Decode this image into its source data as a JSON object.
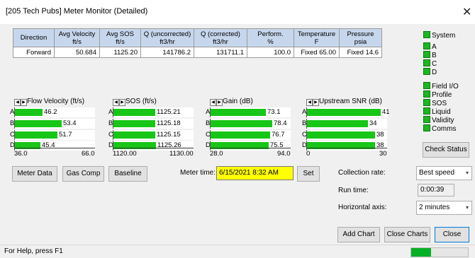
{
  "window": {
    "title": "[205 Tech Pubs] Meter Monitor (Detailed)"
  },
  "table": {
    "headers": [
      "Direction",
      "Avg Velocity\nft/s",
      "Avg SOS\nft/s",
      "Q (uncorrected)\nft3/hr",
      "Q (corrected)\nft3/hr",
      "Perform.\n%",
      "Temperature\nF",
      "Pressure\npsia"
    ],
    "rows": [
      [
        "Forward",
        "50.684",
        "1125.20",
        "141786.2",
        "131711.1",
        "100.0",
        "Fixed 65.00",
        "Fixed 14.6"
      ]
    ]
  },
  "status_items": [
    {
      "label": "System",
      "color": "#1fb424"
    },
    {
      "label": "A",
      "color": "#1fb424"
    },
    {
      "label": "B",
      "color": "#1fb424"
    },
    {
      "label": "C",
      "color": "#1fb424"
    },
    {
      "label": "D",
      "color": "#1fb424"
    },
    {
      "label": "Field I/O",
      "color": "#1fb424"
    },
    {
      "label": "Profile",
      "color": "#1fb424"
    },
    {
      "label": "SOS",
      "color": "#1fb424"
    },
    {
      "label": "Liquid",
      "color": "#1fb424"
    },
    {
      "label": "Validity",
      "color": "#1fb424"
    },
    {
      "label": "Comms",
      "color": "#1fb424"
    }
  ],
  "buttons": {
    "check_status": "Check Status",
    "meter_data": "Meter Data",
    "gas_comp": "Gas Comp",
    "baseline": "Baseline",
    "set": "Set",
    "add_chart": "Add Chart",
    "close_charts": "Close Charts",
    "close": "Close"
  },
  "gauges": [
    {
      "title": "Flow Velocity (ft/s)",
      "min": 36.0,
      "max": 66.0,
      "min_label": "36.0",
      "max_label": "66.0",
      "rows": [
        {
          "path": "A",
          "value": 46.2,
          "label": "46.2"
        },
        {
          "path": "B",
          "value": 53.4,
          "label": "53.4"
        },
        {
          "path": "C",
          "value": 51.7,
          "label": "51.7"
        },
        {
          "path": "D",
          "value": 45.4,
          "label": "45.4"
        }
      ]
    },
    {
      "title": "SOS (ft/s)",
      "min": 1120.0,
      "max": 1130.0,
      "min_label": "1120.00",
      "max_label": "1130.00",
      "rows": [
        {
          "path": "A",
          "value": 1125.21,
          "label": "1125.21"
        },
        {
          "path": "B",
          "value": 1125.18,
          "label": "1125.18"
        },
        {
          "path": "C",
          "value": 1125.15,
          "label": "1125.15"
        },
        {
          "path": "D",
          "value": 1125.26,
          "label": "1125.26"
        }
      ]
    },
    {
      "title": "Gain (dB)",
      "min": 28.0,
      "max": 94.0,
      "min_label": "28.0",
      "max_label": "94.0",
      "rows": [
        {
          "path": "A",
          "value": 73.1,
          "label": "73.1"
        },
        {
          "path": "B",
          "value": 78.4,
          "label": "78.4"
        },
        {
          "path": "C",
          "value": 76.7,
          "label": "76.7"
        },
        {
          "path": "D",
          "value": 75.5,
          "label": "75.5"
        }
      ]
    },
    {
      "title": "Upstream SNR (dB)",
      "min": 0,
      "max": 45,
      "min_label": "0",
      "max_label": "30",
      "rows": [
        {
          "path": "A",
          "value": 41,
          "label": "41"
        },
        {
          "path": "B",
          "value": 34,
          "label": "34"
        },
        {
          "path": "C",
          "value": 38,
          "label": "38"
        },
        {
          "path": "D",
          "value": 38,
          "label": "38"
        }
      ]
    }
  ],
  "meter_time": {
    "label": "Meter time:",
    "value": "6/15/2021 8:32 AM"
  },
  "settings": {
    "collection_rate_label": "Collection rate:",
    "collection_rate": "Best speed",
    "run_time_label": "Run time:",
    "run_time": "0:00:39",
    "horizontal_axis_label": "Horizontal axis:",
    "horizontal_axis": "2 minutes"
  },
  "statusbar": {
    "help": "For Help, press F1",
    "progress": 0.35,
    "progress_color": "#06b025"
  },
  "colors": {
    "led": "#1fb424",
    "bar": "#17c617",
    "meter_time_bg": "#ffff00",
    "header_bg": "#c6d6ec"
  }
}
